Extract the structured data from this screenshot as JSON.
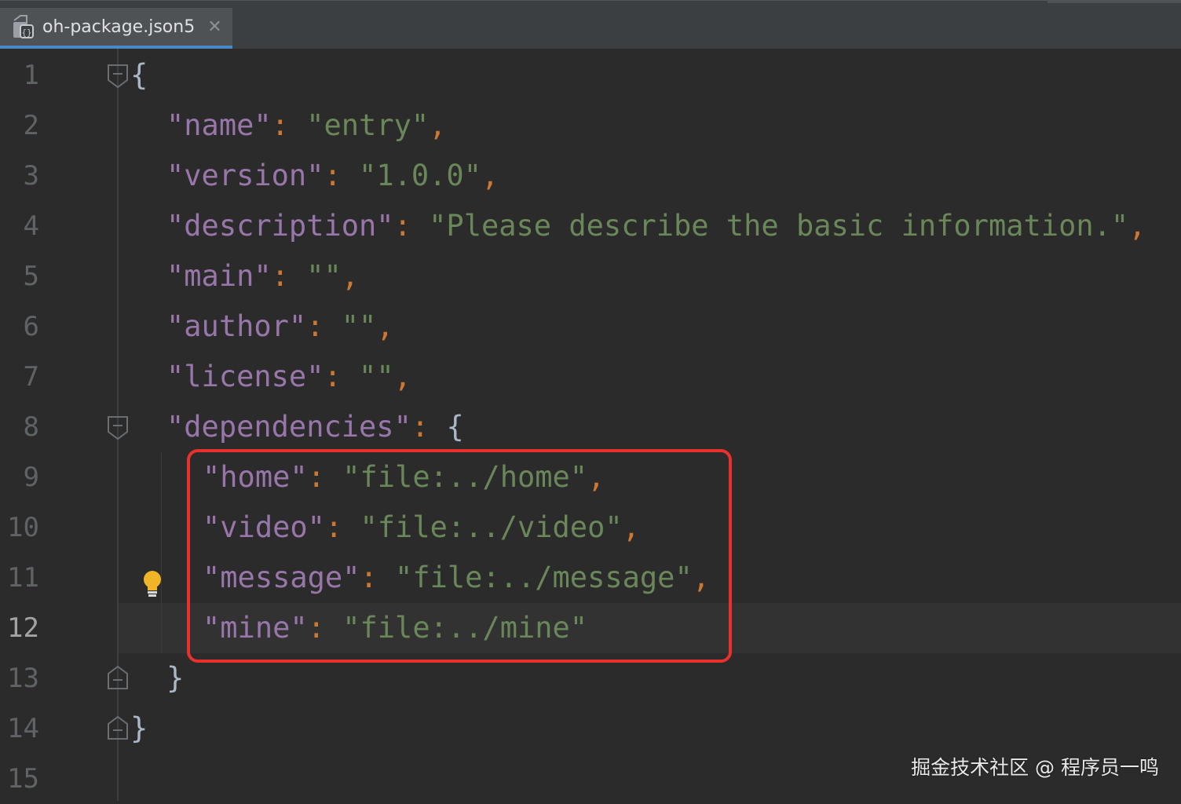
{
  "tab": {
    "filename": "oh-package.json5",
    "close_glyph": "✕",
    "icon": "json-file-icon"
  },
  "editor": {
    "active_line": 12,
    "lines": [
      {
        "num": "1"
      },
      {
        "num": "2",
        "key": "\"name\"",
        "colon": ": ",
        "value": "\"entry\"",
        "comma": ","
      },
      {
        "num": "3",
        "key": "\"version\"",
        "colon": ": ",
        "value": "\"1.0.0\"",
        "comma": ","
      },
      {
        "num": "4",
        "key": "\"description\"",
        "colon": ": ",
        "value": "\"Please describe the basic information.\"",
        "comma": ","
      },
      {
        "num": "5",
        "key": "\"main\"",
        "colon": ": ",
        "value": "\"\"",
        "comma": ","
      },
      {
        "num": "6",
        "key": "\"author\"",
        "colon": ": ",
        "value": "\"\"",
        "comma": ","
      },
      {
        "num": "7",
        "key": "\"license\"",
        "colon": ": ",
        "value": "\"\"",
        "comma": ","
      },
      {
        "num": "8",
        "key": "\"dependencies\"",
        "colon": ": ",
        "brace": "{"
      },
      {
        "num": "9",
        "key": "\"home\"",
        "colon": ": ",
        "value": "\"file:../home\"",
        "comma": ","
      },
      {
        "num": "10",
        "key": "\"video\"",
        "colon": ": ",
        "value": "\"file:../video\"",
        "comma": ","
      },
      {
        "num": "11",
        "key": "\"message\"",
        "colon": ": ",
        "value": "\"file:../message\"",
        "comma": ","
      },
      {
        "num": "12",
        "key": "\"mine\"",
        "colon": ": ",
        "value": "\"file:../mine\""
      },
      {
        "num": "13",
        "brace": "}"
      },
      {
        "num": "14",
        "brace": "}"
      },
      {
        "num": "15"
      }
    ],
    "line1_brace": "{"
  },
  "colors": {
    "background": "#2b2b2b",
    "key": "#9876aa",
    "string": "#6a8759",
    "punctuation": "#cc7832",
    "highlight_border": "#e8302d"
  },
  "watermark": "掘金技术社区 @ 程序员一鸣"
}
